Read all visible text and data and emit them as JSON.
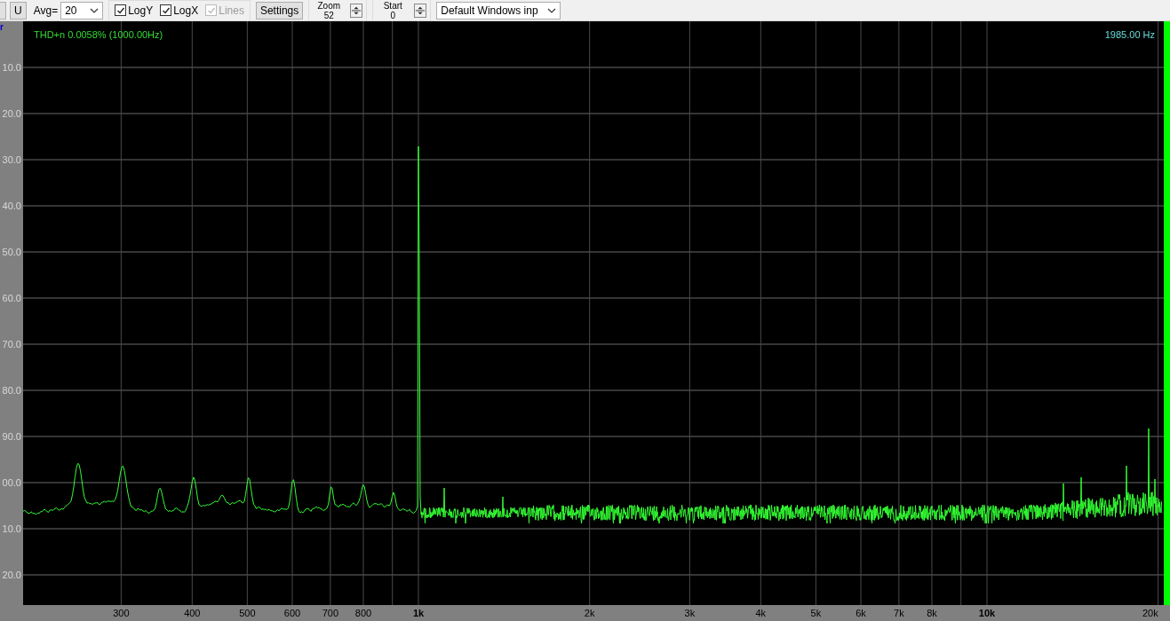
{
  "toolbar": {
    "u_button": "U",
    "avg_label": "Avg=",
    "avg_select": "20",
    "checkboxes": [
      {
        "label": "LogY",
        "checked": true,
        "disabled": false
      },
      {
        "label": "LogX",
        "checked": true,
        "disabled": false
      },
      {
        "label": "Lines",
        "checked": true,
        "disabled": true
      }
    ],
    "settings_button": "Settings",
    "zoom": {
      "label": "Zoom",
      "value": "52"
    },
    "start": {
      "label": "Start",
      "value": "0"
    },
    "input_select": "Default Windows inp"
  },
  "plot": {
    "corner_mark": "r",
    "thd_readout": "THD+n 0.0058% (1000.00Hz)",
    "frequency_readout": "1985.00 Hz",
    "y_labels": [
      "10.0",
      "20.0",
      "30.0",
      "40.0",
      "50.0",
      "60.0",
      "70.0",
      "80.0",
      "90.0",
      "00.0",
      "10.0",
      "20.0"
    ],
    "x_labels": [
      {
        "text": "300",
        "major": false
      },
      {
        "text": "400",
        "major": false
      },
      {
        "text": "500",
        "major": false
      },
      {
        "text": "600",
        "major": false
      },
      {
        "text": "700",
        "major": false
      },
      {
        "text": "800",
        "major": false
      },
      {
        "text": "1k",
        "major": true
      },
      {
        "text": "2k",
        "major": false
      },
      {
        "text": "3k",
        "major": false
      },
      {
        "text": "4k",
        "major": false
      },
      {
        "text": "5k",
        "major": false
      },
      {
        "text": "6k",
        "major": false
      },
      {
        "text": "7k",
        "major": false
      },
      {
        "text": "8k",
        "major": false
      },
      {
        "text": "10k",
        "major": true
      },
      {
        "text": "20k",
        "major": false
      }
    ]
  }
}
